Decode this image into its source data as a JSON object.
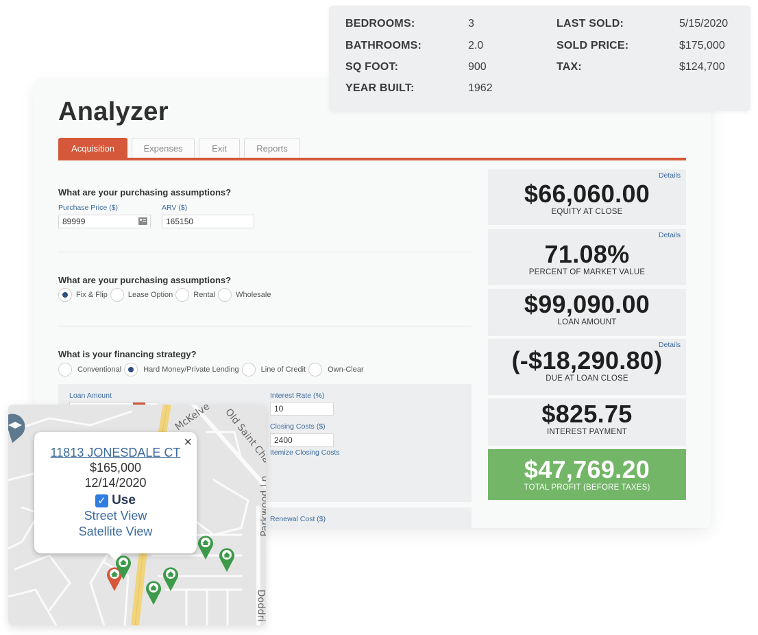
{
  "property": {
    "left": [
      {
        "label": "BEDROOMS:",
        "value": "3"
      },
      {
        "label": "BATHROOMS:",
        "value": "2.0"
      },
      {
        "label": "SQ FOOT:",
        "value": "900"
      },
      {
        "label": "YEAR BUILT:",
        "value": "1962"
      }
    ],
    "right": [
      {
        "label": "LAST SOLD:",
        "value": "5/15/2020"
      },
      {
        "label": "SOLD PRICE:",
        "value": "$175,000"
      },
      {
        "label": "TAX:",
        "value": "$124,700"
      }
    ]
  },
  "analyzer": {
    "title": "Analyzer",
    "tabs": [
      {
        "label": "Acquisition",
        "active": true
      },
      {
        "label": "Expenses",
        "active": false
      },
      {
        "label": "Exit",
        "active": false
      },
      {
        "label": "Reports",
        "active": false
      }
    ],
    "section1": {
      "question": "What are your purchasing assumptions?",
      "purchase_price_label": "Purchase Price ($)",
      "purchase_price_value": "89999",
      "arv_label": "ARV ($)",
      "arv_value": "165150"
    },
    "section2": {
      "question": "What are your purchasing assumptions?",
      "options": [
        "Fix & Flip",
        "Lease Option",
        "Rental",
        "Wholesale"
      ],
      "selected": "Fix & Flip"
    },
    "section3": {
      "question": "What is your financing strategy?",
      "options": [
        "Conventional",
        "Hard Money/Private Lending",
        "Line of Credit",
        "Own-Clear"
      ],
      "selected": "Hard Money/Private Lending"
    },
    "loan": {
      "loan_amount_label": "Loan Amount",
      "interest_rate_label": "Interest Rate (%)",
      "interest_rate_value": "10",
      "closing_costs_label": "Closing Costs ($)",
      "closing_costs_value": "2400",
      "itemize_link": "Itemize Closing Costs",
      "renewal_cost_label": "Renewal Cost ($)"
    },
    "metrics": [
      {
        "value": "$66,060.00",
        "label": "EQUITY AT CLOSE",
        "details": "Details"
      },
      {
        "value": "71.08%",
        "label": "PERCENT OF MARKET VALUE",
        "details": "Details"
      },
      {
        "value": "$99,090.00",
        "label": "LOAN AMOUNT",
        "details": null
      },
      {
        "value": "(-$18,290.80)",
        "label": "DUE AT LOAN CLOSE",
        "details": "Details"
      },
      {
        "value": "$825.75",
        "label": "INTEREST PAYMENT",
        "details": null
      },
      {
        "value": "$47,769.20",
        "label": "TOTAL PROFIT (BEFORE TAXES)",
        "details": null
      }
    ],
    "colors": {
      "accent": "#d5583a",
      "link": "#3c6a9c",
      "profit": "#73b667"
    }
  },
  "map": {
    "streets": [
      "McKelve",
      "Old Saint Char",
      "Parkwood Ln",
      "Doddri"
    ],
    "popup": {
      "address": "11813 JONESDALE CT",
      "price": "$165,000",
      "date": "12/14/2020",
      "use_label": "Use",
      "use_checked": true,
      "street_view": "Street View",
      "satellite_view": "Satellite View",
      "close": "×"
    }
  }
}
